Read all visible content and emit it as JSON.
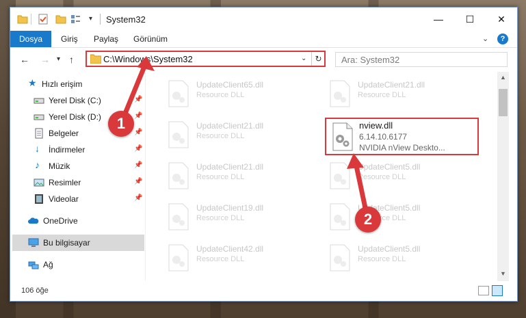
{
  "titlebar": {
    "title": "System32",
    "controls": {
      "minimize": "—",
      "maximize": "☐",
      "close": "✕"
    }
  },
  "ribbon": {
    "tabs": [
      {
        "label": "Dosya"
      },
      {
        "label": "Giriş"
      },
      {
        "label": "Paylaş"
      },
      {
        "label": "Görünüm"
      }
    ],
    "help_label": "?"
  },
  "navbar": {
    "address": "C:\\Windows\\System32",
    "search_placeholder": "Ara: System32"
  },
  "sidebar": {
    "items": [
      {
        "label": "Hızlı erişim",
        "icon": "star-icon"
      },
      {
        "label": "Yerel Disk (C:)",
        "icon": "drive-icon",
        "pinned": true
      },
      {
        "label": "Yerel Disk (D:)",
        "icon": "drive-icon",
        "pinned": true
      },
      {
        "label": "Belgeler",
        "icon": "documents-icon",
        "pinned": true
      },
      {
        "label": "İndirmeler",
        "icon": "download-icon",
        "pinned": true
      },
      {
        "label": "Müzik",
        "icon": "music-icon",
        "pinned": true
      },
      {
        "label": "Resimler",
        "icon": "pictures-icon",
        "pinned": true
      },
      {
        "label": "Videolar",
        "icon": "videos-icon",
        "pinned": true
      },
      {
        "label": "OneDrive",
        "icon": "cloud-icon"
      },
      {
        "label": "Bu bilgisayar",
        "icon": "computer-icon",
        "selected": true
      },
      {
        "label": "Ağ",
        "icon": "network-icon"
      }
    ]
  },
  "files": {
    "left": [
      {
        "name": "UpdateClient65.dll",
        "desc": "Resource DLL"
      },
      {
        "name": "UpdateClient21.dll",
        "desc": "Resource DLL"
      },
      {
        "name": "UpdateClient21.dll",
        "desc": "Resource DLL"
      },
      {
        "name": "UpdateClient19.dll",
        "desc": "Resource DLL"
      },
      {
        "name": "UpdateClient42.dll",
        "desc": "Resource DLL"
      }
    ],
    "right": [
      {
        "name": "UpdateClient21.dll",
        "desc": "Resource DLL"
      },
      {
        "name": "UpdateClient5.dll",
        "desc": "Resource DLL"
      },
      {
        "name": "UpdateClient5.dll",
        "desc": "Resource DLL"
      },
      {
        "name": "UpdateClient5.dll",
        "desc": "Resource DLL"
      }
    ],
    "highlighted": {
      "name": "nview.dll",
      "version": "6.14.10.6177",
      "desc": "NVIDIA nView Deskto..."
    }
  },
  "status": {
    "count": "106 öğe"
  },
  "annotations": {
    "step1": "1",
    "step2": "2",
    "color": "#d9393a"
  }
}
